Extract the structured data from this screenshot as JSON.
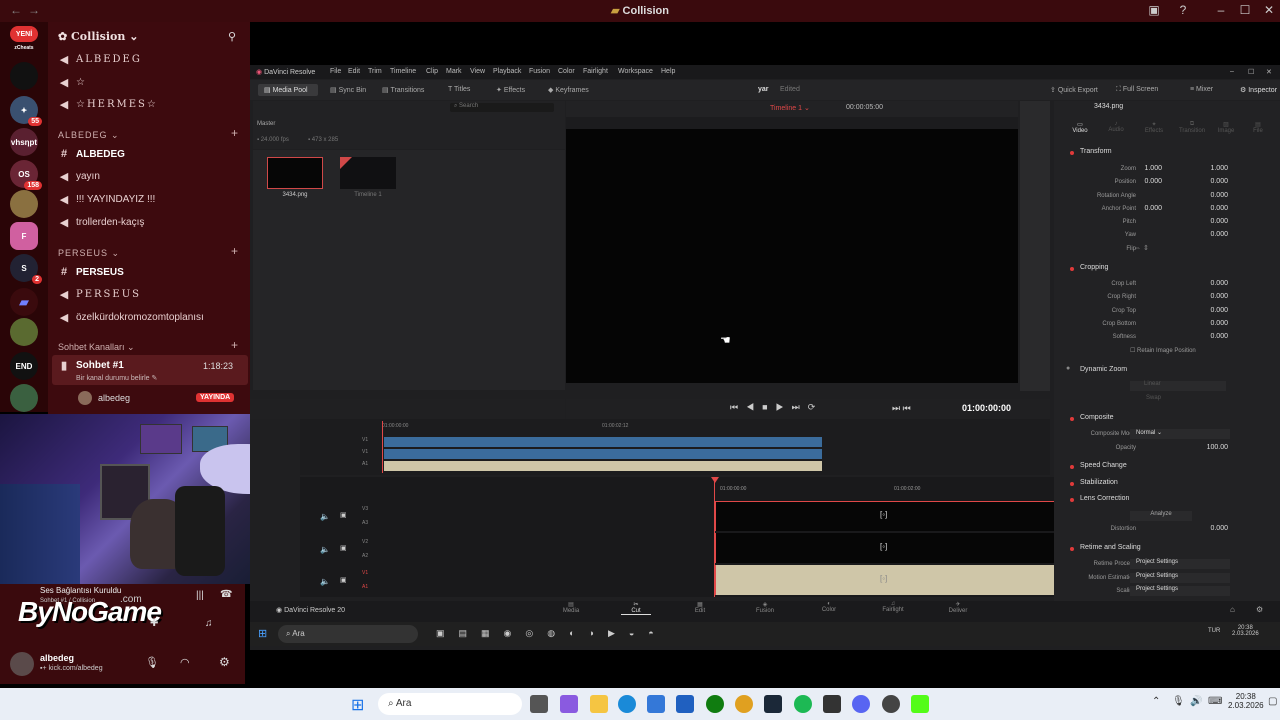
{
  "discord": {
    "window_title": "Collision",
    "server_name": "Collision",
    "new_badge": "YENİ",
    "rail": {
      "cheats_label": "zCheats",
      "badge1": "55",
      "vhsnpt_label": "vhsηpt",
      "os_label": "OS",
      "badge2": "158",
      "badge3": "2",
      "end_label": "END"
    },
    "top_channels": [
      {
        "icon": "megaphone",
        "label": "ALBEDEG"
      },
      {
        "icon": "megaphone",
        "label": "☆"
      },
      {
        "icon": "megaphone",
        "label": "☆HERMES☆"
      }
    ],
    "category1": "ALBEDEG",
    "category1_channels": [
      {
        "icon": "hash",
        "label": "ALBEDEG",
        "bold": true
      },
      {
        "icon": "megaphone",
        "label": "yayın"
      },
      {
        "icon": "megaphone",
        "label": "!!! YAYINDAYIZ !!!"
      },
      {
        "icon": "megaphone",
        "label": "trollerden-kaçış"
      }
    ],
    "category2": "PERSEUS",
    "category2_channels": [
      {
        "icon": "hash",
        "label": "PERSEUS",
        "bold": true
      },
      {
        "icon": "megaphone",
        "label": "PERSEUS"
      },
      {
        "icon": "megaphone",
        "label": "özelkürdokromozomtoplanısı"
      }
    ],
    "category3": "Sohbet Kanalları",
    "voice_channel": {
      "name": "Sohbet #1",
      "time": "1:18:23",
      "status": "Bir kanal durumu belirle",
      "member": "albedeg",
      "live_badge": "YAYINDA"
    },
    "connection": {
      "status": "Ses Bağlantısı Kuruldu",
      "sub": "Sohbet #1 / Collision"
    },
    "user": {
      "name": "albedeg",
      "sub": "kick.com/albedeg"
    },
    "overlay_text": "ByNoGame",
    "overlay_sub": ".com"
  },
  "resolve": {
    "app_title": "DaVinci Resolve",
    "menus": [
      "File",
      "Edit",
      "Trim",
      "Timeline",
      "Clip",
      "Mark",
      "View",
      "Playback",
      "Fusion",
      "Color",
      "Fairlight",
      "Workspace",
      "Help"
    ],
    "toolbar_left": [
      "Media Pool",
      "Sync Bin",
      "Transitions",
      "Titles",
      "Effects",
      "Keyframes"
    ],
    "project_name": "yar",
    "project_state": "Edited",
    "toolbar_right": [
      "Quick Export",
      "Full Screen",
      "Mixer",
      "Inspector"
    ],
    "search_placeholder": "Search",
    "timeline_name": "Timeline 1",
    "timecode_top": "00:00:05:00",
    "bin_name": "Master",
    "fps_info": "24.000 fps",
    "res_info": "473 x 285",
    "clips": [
      {
        "name": "3434.png"
      },
      {
        "name": "Timeline 1"
      }
    ],
    "playhead_timecode": "01:00:00:00",
    "ruler_top": [
      "01:00:00:00",
      "01:00:02:12"
    ],
    "ruler_bottom": [
      "01:00:00:00",
      "01:00:02:00"
    ],
    "tracks_top": [
      "V1",
      "V1",
      "A1"
    ],
    "tracks_bottom": [
      "V3",
      "A3",
      "V2",
      "A2",
      "V1",
      "A1"
    ],
    "inspector": {
      "filename": "3434.png",
      "tabs": [
        "Video",
        "Audio",
        "Effects",
        "Transition",
        "Image",
        "File"
      ],
      "transform_title": "Transform",
      "zoom_label": "Zoom",
      "zoom_x": "1.000",
      "zoom_y": "1.000",
      "position_label": "Position",
      "position_x": "0.000",
      "position_y": "0.000",
      "rotation_label": "Rotation Angle",
      "rotation_val": "0.000",
      "anchor_label": "Anchor Point",
      "anchor_x": "0.000",
      "anchor_y": "0.000",
      "pitch_label": "Pitch",
      "pitch_val": "0.000",
      "yaw_label": "Yaw",
      "yaw_val": "0.000",
      "flip_label": "Flip",
      "cropping_title": "Cropping",
      "crop_left_label": "Crop Left",
      "crop_left_val": "0.000",
      "crop_right_label": "Crop Right",
      "crop_right_val": "0.000",
      "crop_top_label": "Crop Top",
      "crop_top_val": "0.000",
      "crop_bottom_label": "Crop Bottom",
      "crop_bottom_val": "0.000",
      "softness_label": "Softness",
      "softness_val": "0.000",
      "retain_label": "Retain Image Position",
      "dynamic_zoom_title": "Dynamic Zoom",
      "dz_ease": "Linear",
      "dz_swap": "Swap",
      "composite_title": "Composite",
      "composite_mode_label": "Composite Mode",
      "composite_mode_val": "Normal",
      "opacity_label": "Opacity",
      "opacity_val": "100.00",
      "speed_change_title": "Speed Change",
      "stabilization_title": "Stabilization",
      "lens_title": "Lens Correction",
      "analyze_label": "Analyze",
      "distortion_label": "Distortion",
      "distortion_val": "0.000",
      "retime_title": "Retime and Scaling",
      "retime_process_label": "Retime Process",
      "retime_process_val": "Project Settings",
      "motion_est_label": "Motion Estimation",
      "motion_est_val": "Project Settings",
      "scaling_label": "Scaling",
      "scaling_val": "Project Settings"
    },
    "brand": "DaVinci Resolve 20",
    "pages": [
      "Media",
      "Cut",
      "Edit",
      "Fusion",
      "Color",
      "Fairlight",
      "Deliver"
    ],
    "active_page": "Cut"
  },
  "inner_taskbar": {
    "search": "Ara",
    "time": "20:38",
    "date": "2.03.2026",
    "lang": "TUR"
  },
  "taskbar": {
    "search": "Ara",
    "time": "20:38",
    "date": "2.03.2026"
  }
}
